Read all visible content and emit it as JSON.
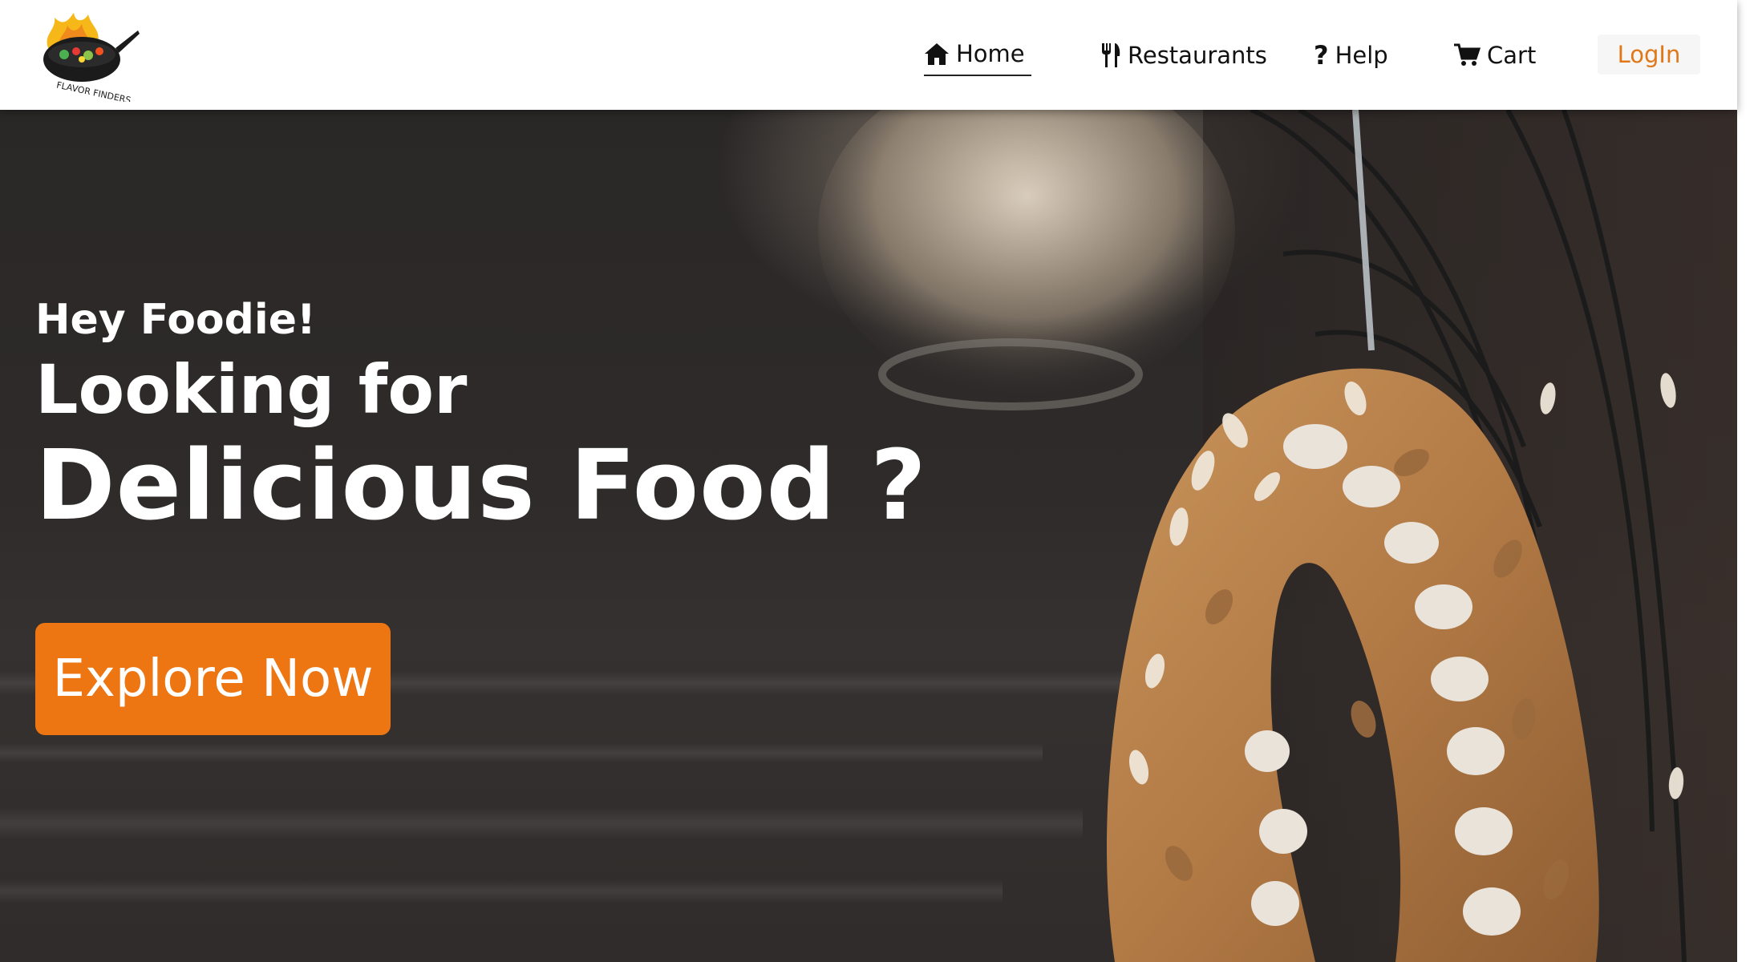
{
  "brand": {
    "logo_text": "FLAVOR FINDERS",
    "logo_icon": "wok-flame-logo"
  },
  "nav": {
    "items": [
      {
        "label": "Home",
        "icon": "home-icon",
        "active": true
      },
      {
        "label": "Restaurants",
        "icon": "fork-knife-icon",
        "active": false
      },
      {
        "label": "Help",
        "icon": "question-icon",
        "active": false
      },
      {
        "label": "Cart",
        "icon": "cart-icon",
        "active": false
      }
    ],
    "login_label": "LogIn"
  },
  "hero": {
    "eyebrow": "Hey Foodie!",
    "line1": "Looking for",
    "line2": "Delicious Food ?",
    "cta_label": "Explore Now",
    "background_image": "almond pastry ring on dark wooden table"
  },
  "colors": {
    "accent": "#ed7612",
    "login_text": "#e0781a",
    "header_bg": "#ffffff",
    "hero_text": "#ffffff"
  }
}
